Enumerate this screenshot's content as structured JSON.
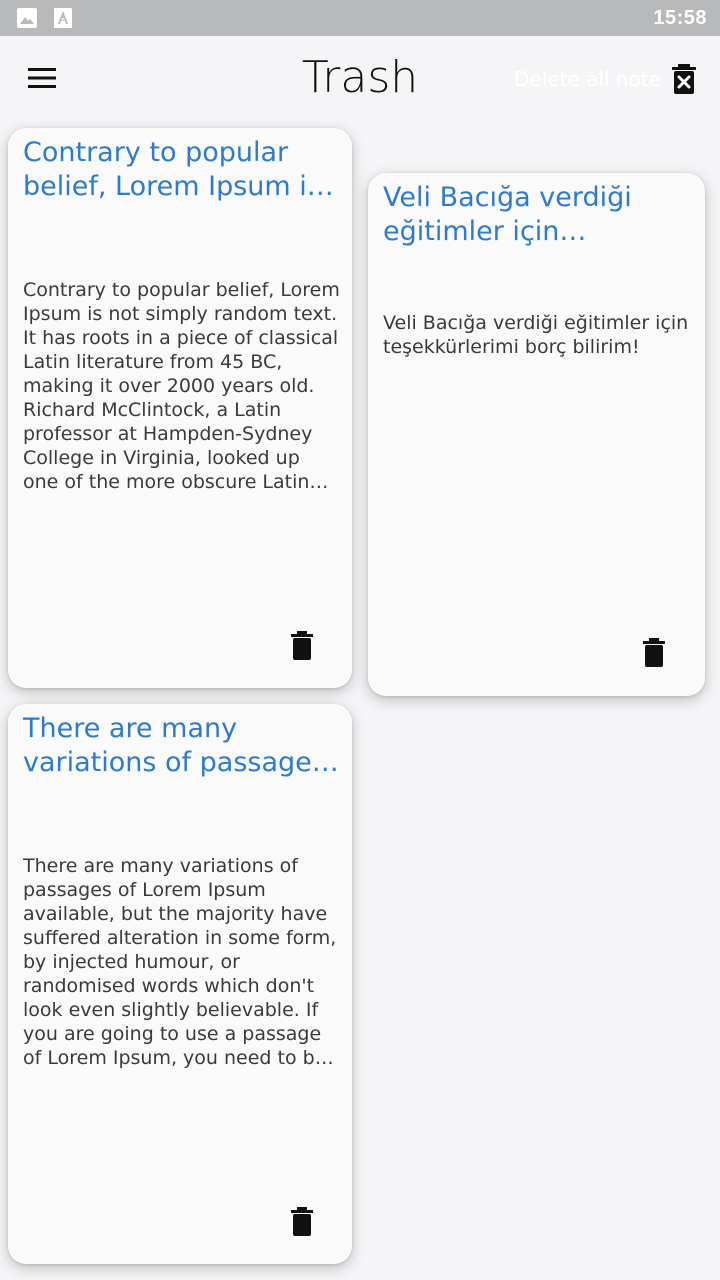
{
  "status_bar": {
    "time": "15:58",
    "icons": [
      "image-icon",
      "font-a-icon"
    ]
  },
  "app_bar": {
    "title": "Trash",
    "delete_all_label": "Delete all note",
    "menu_icon": "hamburger-menu-icon",
    "delete_all_icon": "delete-forever-icon"
  },
  "notes": [
    {
      "title": "Contrary to popular belief, Lorem Ipsum is not simply random text.",
      "body": "Contrary to popular belief, Lorem Ipsum is not simply random text. It has roots in a piece of classical Latin literature from 45 BC, making it over 2000 years old. Richard McClintock, a Latin professor at Hampden-Sydney College in Virginia, looked up one of the more obscure Latin words, consectetur, from a Lorem Ipsum passage.",
      "delete_icon": "trash-icon"
    },
    {
      "title": "Veli Bacığa verdiği eğitimler için teşekkürlerimi borç bilirim!",
      "body": "Veli Bacığa verdiği eğitimler için teşekkürlerimi borç bilirim!",
      "delete_icon": "trash-icon"
    },
    {
      "title": "There are many variations of passages of Lorem Ipsum available",
      "body": "There are many variations of passages of Lorem Ipsum available, but the majority have suffered alteration in some form, by injected humour, or randomised words which don't look even slightly believable. If you are going to use a passage of Lorem Ipsum, you need to be sure there isn't anything embarrassing hidden in the middle of text.",
      "delete_icon": "trash-icon"
    }
  ],
  "colors": {
    "accent": "#2c7bd0",
    "status_bar": "#b8b9bb",
    "background": "#f5f5f7",
    "card": "#fafafb"
  }
}
